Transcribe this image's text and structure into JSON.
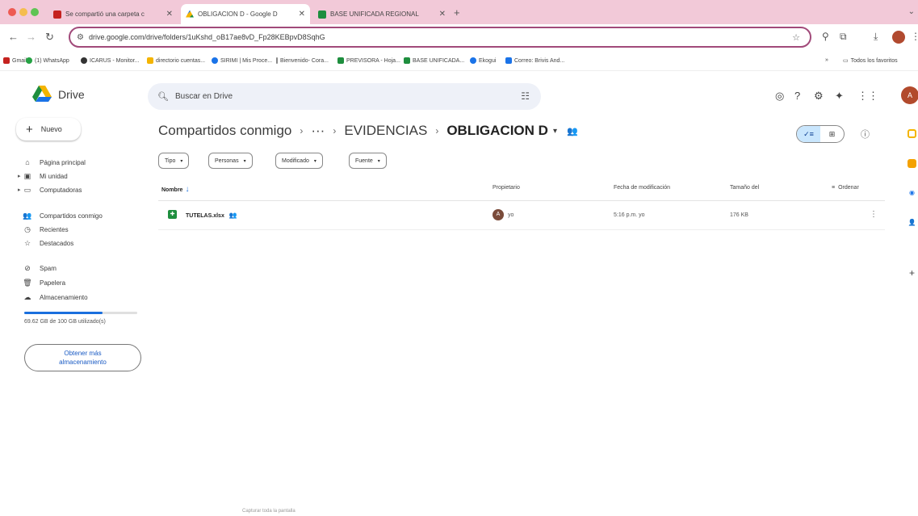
{
  "browser": {
    "tabs": [
      {
        "label": "Se compartió una carpeta c",
        "favicon_color": "#c5221f"
      },
      {
        "label": "OBLIGACION D - Google D",
        "favicon_color": "#1a73e8"
      },
      {
        "label": "BASE UNIFICADA REGIONAL",
        "favicon_color": "#1e8e3e"
      }
    ],
    "url": "drive.google.com/drive/folders/1uKshd_oB17ae8vD_Fp28KEBpvD8SqhG",
    "bookmarks": [
      {
        "label": "Gmail",
        "color": "#c5221f"
      },
      {
        "label": "(1) WhatsApp",
        "color": "#25a244"
      },
      {
        "label": "ICARUS - Monitor...",
        "color": "#333333"
      },
      {
        "label": "directorio cuentas...",
        "color": "#f4b400"
      },
      {
        "label": "SIRIMI | Mis Proce...",
        "color": "#1a73e8"
      },
      {
        "label": "Bienvenido- Cora...",
        "color": "#888888"
      },
      {
        "label": "PREVISORA - Hoja...",
        "color": "#1e8e3e"
      },
      {
        "label": "BASE UNIFICADA...",
        "color": "#1e8e3e"
      },
      {
        "label": "Ekogui",
        "color": "#1a73e8"
      },
      {
        "label": "Correo: Brivis And...",
        "color": "#1a73e8"
      }
    ],
    "all_bookmarks": "Todos los favoritos"
  },
  "app": {
    "name": "Drive",
    "search_placeholder": "Buscar en Drive",
    "account_initial": "A",
    "new_button": "Nuevo"
  },
  "sidebar": {
    "items": [
      {
        "label": "Página principal",
        "icon": "⌂"
      },
      {
        "label": "Mi unidad",
        "icon": "▣"
      },
      {
        "label": "Computadoras",
        "icon": "▭"
      },
      {
        "label": "Compartidos conmigo",
        "icon": "👥"
      },
      {
        "label": "Recientes",
        "icon": "◷"
      },
      {
        "label": "Destacados",
        "icon": "☆"
      },
      {
        "label": "Spam",
        "icon": "⊘"
      },
      {
        "label": "Papelera",
        "icon": "🗑"
      },
      {
        "label": "Almacenamiento",
        "icon": "☁"
      }
    ],
    "storage": {
      "used_fraction": 0.696,
      "text": "69.62 GB de 100 GB utilizado(s)"
    },
    "get_storage_button": "Obtener más almacenamiento"
  },
  "breadcrumb": {
    "root": "Compartidos conmigo",
    "ellipsis": "···",
    "parent": "EVIDENCIAS",
    "current": "OBLIGACION D"
  },
  "filters": [
    "Tipo",
    "Personas",
    "Modificado",
    "Fuente"
  ],
  "columns": {
    "name": "Nombre",
    "owner": "Propietario",
    "modified": "Fecha de modificación",
    "size": "Tamaño del",
    "sort": "Ordenar"
  },
  "files": [
    {
      "name": "TUTELAS.xlsx",
      "owner": "yo",
      "owner_initial": "A",
      "modified": "5:16 p.m. yo",
      "size": "176 KB"
    }
  ],
  "footer_hint": "Capturar toda la pantalla",
  "colors": {
    "accent": "#1a73e8",
    "tabstrip": "#f2c9d8",
    "omnibox_border": "#a14a7a"
  }
}
